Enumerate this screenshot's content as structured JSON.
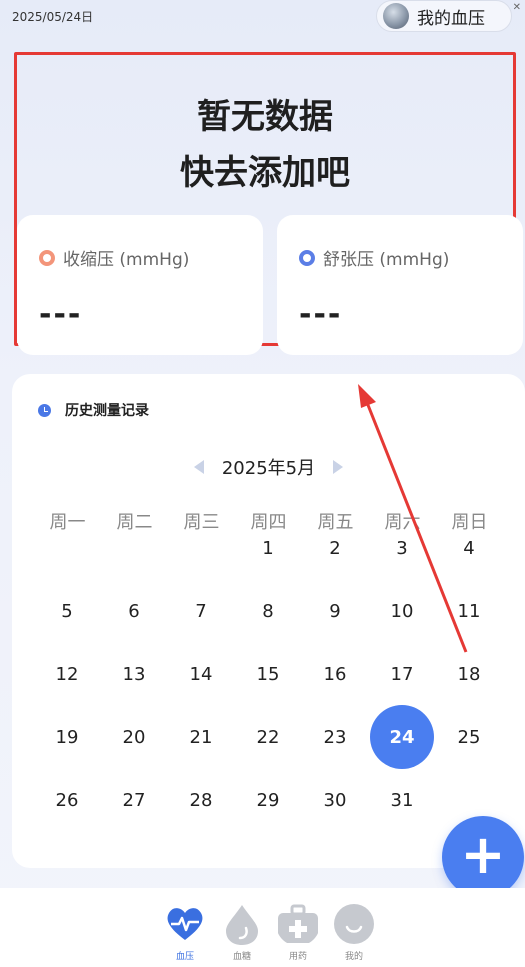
{
  "status": {
    "date": "2025/05/24日",
    "close": "✕"
  },
  "profile": {
    "label": "我的血压",
    "icon": "globe-icon"
  },
  "hero": {
    "line1": "暂无数据",
    "line2": "快去添加吧"
  },
  "systolic": {
    "label": "收缩压 (mmHg)",
    "value": "---",
    "color": "#f3957a"
  },
  "diastolic": {
    "label": "舒张压 (mmHg)",
    "value": "---",
    "color": "#5b7ee6"
  },
  "history": {
    "title": "历史测量记录",
    "month": "2025年5月",
    "weekdays": [
      "周一",
      "周二",
      "周三",
      "周四",
      "周五",
      "周六",
      "周日"
    ],
    "days": [
      "1",
      "2",
      "3",
      "4",
      "5",
      "6",
      "7",
      "8",
      "9",
      "10",
      "11",
      "12",
      "13",
      "14",
      "15",
      "16",
      "17",
      "18",
      "19",
      "20",
      "21",
      "22",
      "23",
      "24",
      "25",
      "26",
      "27",
      "28",
      "29",
      "30",
      "31"
    ],
    "first_weekday_index": 3,
    "selected_day": "24"
  },
  "fab": {
    "label": "+"
  },
  "tabs": [
    {
      "label": "血压",
      "icon": "heart-pulse-icon",
      "active": true
    },
    {
      "label": "血糖",
      "icon": "drop-icon",
      "active": false
    },
    {
      "label": "用药",
      "icon": "medkit-icon",
      "active": false
    },
    {
      "label": "我的",
      "icon": "smile-icon",
      "active": false
    }
  ],
  "colors": {
    "accent": "#4a7ef0",
    "highlight_box": "#e53935"
  }
}
